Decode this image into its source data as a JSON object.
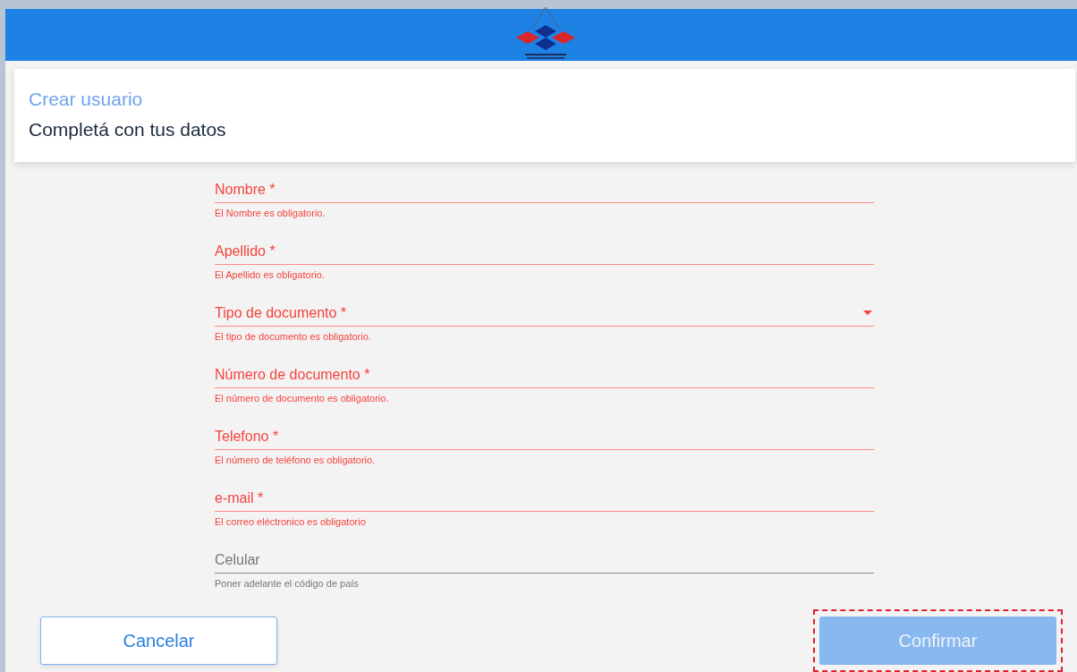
{
  "header": {
    "title": "Crear usuario",
    "subtitle": "Completá con tus datos"
  },
  "fields": [
    {
      "kind": "text",
      "label": "Nombre *",
      "error": true,
      "hint": "El Nombre es obligatorio."
    },
    {
      "kind": "text",
      "label": "Apellido *",
      "error": true,
      "hint": "El Apellido es obligatorio."
    },
    {
      "kind": "select",
      "label": "Tipo de documento *",
      "error": true,
      "hint": "El tipo de documento es obligatorio."
    },
    {
      "kind": "text",
      "label": "Número de documento *",
      "error": true,
      "hint": "El número de documento es obligatorio."
    },
    {
      "kind": "text",
      "label": "Telefono *",
      "error": true,
      "hint": "El número de teléfono es obligatorio."
    },
    {
      "kind": "text",
      "label": "e-mail *",
      "error": true,
      "hint": "El correo eléctronico es obligatorio"
    },
    {
      "kind": "text",
      "label": "Celular",
      "error": false,
      "hint": "Poner adelante el código de país"
    }
  ],
  "buttons": [
    {
      "kind": "outline",
      "label": "Cancelar",
      "disabled": false,
      "highlighted": false
    },
    {
      "kind": "filled",
      "label": "Confirmar",
      "disabled": true,
      "highlighted": true
    }
  ]
}
